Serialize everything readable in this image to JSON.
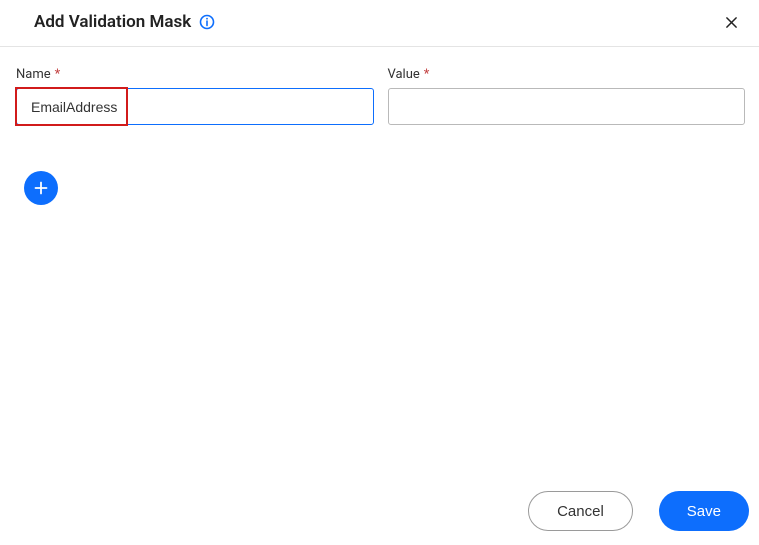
{
  "header": {
    "title": "Add Validation Mask"
  },
  "fields": {
    "name": {
      "label": "Name",
      "value": "EmailAddress"
    },
    "value_field": {
      "label": "Value",
      "value": ""
    }
  },
  "footer": {
    "cancel_label": "Cancel",
    "save_label": "Save"
  }
}
